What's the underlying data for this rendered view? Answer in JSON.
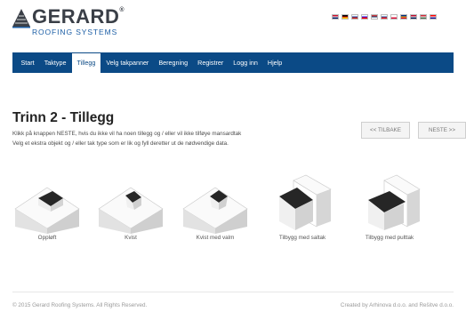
{
  "header": {
    "brand": "GERARD",
    "trademark": "®",
    "tagline": "ROOFING SYSTEMS",
    "languages": [
      {
        "icon": "flag-uk-icon",
        "colors": [
          "#c8102e",
          "#ffffff",
          "#012169"
        ]
      },
      {
        "icon": "flag-de-icon",
        "colors": [
          "#000000",
          "#dd0000",
          "#ffce00"
        ]
      },
      {
        "icon": "flag-ru-icon",
        "colors": [
          "#ffffff",
          "#0039a6",
          "#d52b1e"
        ]
      },
      {
        "icon": "flag-si-icon",
        "colors": [
          "#ffffff",
          "#0000ff",
          "#ff0000"
        ]
      },
      {
        "icon": "flag-rs-icon",
        "colors": [
          "#c6363c",
          "#0c4076",
          "#ffffff"
        ]
      },
      {
        "icon": "flag-sk-icon",
        "colors": [
          "#ffffff",
          "#0b4ea2",
          "#ee1c25"
        ]
      },
      {
        "icon": "flag-pl-icon",
        "colors": [
          "#ffffff",
          "#ffffff",
          "#dc143c"
        ]
      },
      {
        "icon": "flag-ro-icon",
        "colors": [
          "#002b7f",
          "#fcd116",
          "#ce1126"
        ]
      },
      {
        "icon": "flag-no-icon",
        "colors": [
          "#ba0c2f",
          "#ffffff",
          "#00205b"
        ]
      },
      {
        "icon": "flag-hu-icon",
        "colors": [
          "#ce2939",
          "#ffffff",
          "#477050"
        ]
      },
      {
        "icon": "flag-hr-icon",
        "colors": [
          "#ff0000",
          "#ffffff",
          "#171796"
        ]
      }
    ]
  },
  "nav": {
    "items": [
      "Start",
      "Taktype",
      "Tillegg",
      "Velg takpanner",
      "Beregning",
      "Registrer",
      "Logg inn",
      "Hjelp"
    ],
    "active": "Tillegg"
  },
  "main": {
    "title": "Trinn 2 - Tillegg",
    "line1": "Klikk på knappen NESTE, hvis du ikke vil ha noen tillegg og / eller vil ikke tilføye mansardtak",
    "line2": "Velg et ekstra objekt og / eller tak type som er lik og fyll deretter ut de nødvendige data.",
    "back_label": "<< TILBAKE",
    "next_label": "NESTE >>"
  },
  "options": [
    {
      "label": "Oppløft",
      "icon": "dormer-raise-icon"
    },
    {
      "label": "Kvist",
      "icon": "dormer-icon"
    },
    {
      "label": "Kvist med valm",
      "icon": "dormer-hip-icon"
    },
    {
      "label": "Tilbygg med saltak",
      "icon": "extension-gable-icon"
    },
    {
      "label": "Tilbygg med pulttak",
      "icon": "extension-shed-icon"
    }
  ],
  "footer": {
    "copyright": "© 2015 Gerard Roofing Systems. All Rights Reserved.",
    "credits": "Created by Arhinova d.o.o. and Rešitve d.o.o."
  },
  "colors": {
    "nav_bg": "#0b4a86",
    "roof": "#262626",
    "wall": "#f2f2f2"
  }
}
